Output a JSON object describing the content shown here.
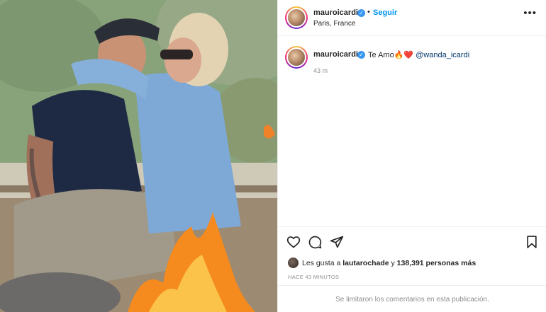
{
  "post": {
    "username": "mauroicardi",
    "follow_label": "Seguir",
    "separator": "•",
    "location": "Paris, France",
    "more_label": "•••",
    "verified_mark": "✓"
  },
  "caption": {
    "username": "mauroicardi",
    "text": "Te Amo",
    "emojis": "🔥❤️",
    "mention": "@wanda_icardi",
    "time": "43 m"
  },
  "engagement": {
    "likes_prefix": "Les gusta a",
    "liked_by": "lautarochade",
    "likes_mid": "y",
    "likes_count": "138,391 personas más",
    "post_age": "HACE 43 MINUTOS",
    "comments_notice": "Se limitaron los comentarios en esta publicación."
  },
  "icons": {
    "like": "heart-icon",
    "comment": "comment-icon",
    "share": "paper-plane-icon",
    "save": "bookmark-icon",
    "more": "more-options-icon",
    "verified": "verified-badge-icon"
  },
  "colors": {
    "link_blue": "#0095f6",
    "verified_blue": "#3897f0",
    "mention_blue": "#00376b",
    "muted_gray": "#8e8e8e",
    "text_dark": "#262626"
  }
}
